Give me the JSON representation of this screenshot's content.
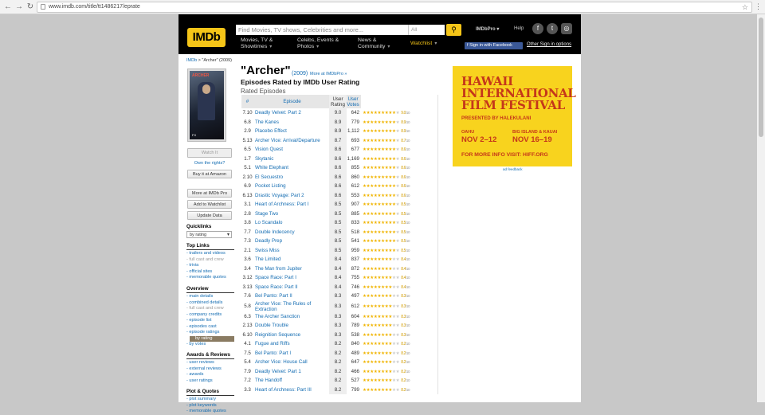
{
  "browser": {
    "url": "www.imdb.com/title/tt1486217/eprate"
  },
  "header": {
    "logo": "IMDb",
    "search_placeholder": "Find Movies, TV shows, Celebrities and more...",
    "search_category": "All",
    "imdbpro": "IMDbPro",
    "help": "Help",
    "menu": [
      "Movies, TV & Showtimes",
      "Celebs, Events & Photos",
      "News & Community",
      "Watchlist"
    ],
    "fb_signin": "Sign in with Facebook",
    "other_signin": "Other Sign in options"
  },
  "breadcrumb": {
    "home": "IMDb",
    "sep": " > ",
    "current": "\"Archer\" (2009)"
  },
  "poster": {
    "title": "ARCHER",
    "network": "FX"
  },
  "sidebar": {
    "watch": "Watch It",
    "own": "Own the rights?",
    "buy": "Buy it at Amazon",
    "more_pro": "More at IMDb Pro",
    "add_watchlist": "Add to Watchlist",
    "update": "Update Data",
    "quicklinks": "Quicklinks",
    "quick_select": "by rating",
    "top_links_h": "Top Links",
    "top_links": [
      "trailers and videos",
      "full cast and crew",
      "trivia",
      "official sites",
      "memorable quotes"
    ],
    "overview_h": "Overview",
    "overview": [
      "main details",
      "combined details",
      "full cast and crew",
      "company credits",
      "episode list",
      "episodes cast",
      "episode ratings",
      "by rating",
      "by votes"
    ],
    "awards_h": "Awards & Reviews",
    "awards": [
      "user reviews",
      "external reviews",
      "awards",
      "user ratings"
    ],
    "plot_h": "Plot & Quotes",
    "plot": [
      "plot summary",
      "plot keywords",
      "memorable quotes"
    ]
  },
  "main": {
    "title": "\"Archer\"",
    "year": "(2009)",
    "more_pro": "More at IMDbPro »",
    "subtitle": "Episodes Rated by IMDb User Rating",
    "rated_label": "Rated Episodes",
    "columns": [
      "#",
      "Episode",
      "User Rating",
      "User Votes"
    ],
    "episodes": [
      {
        "num": "7.10",
        "title": "Deadly Velvet: Part 2",
        "rating": "9.0",
        "votes": "642"
      },
      {
        "num": "6.8",
        "title": "The Kanes",
        "rating": "8.9",
        "votes": "779"
      },
      {
        "num": "2.9",
        "title": "Placebo Effect",
        "rating": "8.9",
        "votes": "1,112"
      },
      {
        "num": "5.13",
        "title": "Archer Vice: Arrival/Departure",
        "rating": "8.7",
        "votes": "693"
      },
      {
        "num": "6.5",
        "title": "Vision Quest",
        "rating": "8.6",
        "votes": "677"
      },
      {
        "num": "1.7",
        "title": "Skytanic",
        "rating": "8.6",
        "votes": "1,169"
      },
      {
        "num": "5.1",
        "title": "White Elephant",
        "rating": "8.6",
        "votes": "855"
      },
      {
        "num": "2.10",
        "title": "El Secuestro",
        "rating": "8.6",
        "votes": "860"
      },
      {
        "num": "6.9",
        "title": "Pocket Listing",
        "rating": "8.6",
        "votes": "612"
      },
      {
        "num": "6.13",
        "title": "Drastic Voyage: Part 2",
        "rating": "8.6",
        "votes": "553"
      },
      {
        "num": "3.1",
        "title": "Heart of Archness: Part I",
        "rating": "8.5",
        "votes": "907"
      },
      {
        "num": "2.8",
        "title": "Stage Two",
        "rating": "8.5",
        "votes": "885"
      },
      {
        "num": "3.8",
        "title": "Lo Scandalo",
        "rating": "8.5",
        "votes": "833"
      },
      {
        "num": "7.7",
        "title": "Double Indecency",
        "rating": "8.5",
        "votes": "518"
      },
      {
        "num": "7.3",
        "title": "Deadly Prep",
        "rating": "8.5",
        "votes": "541"
      },
      {
        "num": "2.1",
        "title": "Swiss Miss",
        "rating": "8.5",
        "votes": "959"
      },
      {
        "num": "3.6",
        "title": "The Limited",
        "rating": "8.4",
        "votes": "837"
      },
      {
        "num": "3.4",
        "title": "The Man from Jupiter",
        "rating": "8.4",
        "votes": "872"
      },
      {
        "num": "3.12",
        "title": "Space Race: Part I",
        "rating": "8.4",
        "votes": "755"
      },
      {
        "num": "3.13",
        "title": "Space Race: Part II",
        "rating": "8.4",
        "votes": "746"
      },
      {
        "num": "7.6",
        "title": "Bel Panto: Part II",
        "rating": "8.3",
        "votes": "497"
      },
      {
        "num": "5.8",
        "title": "Archer Vice: The Rules of Extraction",
        "rating": "8.3",
        "votes": "612"
      },
      {
        "num": "6.3",
        "title": "The Archer Sanction",
        "rating": "8.3",
        "votes": "604"
      },
      {
        "num": "2.13",
        "title": "Double Trouble",
        "rating": "8.3",
        "votes": "789"
      },
      {
        "num": "6.10",
        "title": "Reignition Sequence",
        "rating": "8.3",
        "votes": "538"
      },
      {
        "num": "4.1",
        "title": "Fugue and Riffs",
        "rating": "8.2",
        "votes": "840"
      },
      {
        "num": "7.5",
        "title": "Bel Panto: Part I",
        "rating": "8.2",
        "votes": "489"
      },
      {
        "num": "5.4",
        "title": "Archer Vice: House Call",
        "rating": "8.2",
        "votes": "647"
      },
      {
        "num": "7.9",
        "title": "Deadly Velvet: Part 1",
        "rating": "8.2",
        "votes": "466"
      },
      {
        "num": "7.2",
        "title": "The Handoff",
        "rating": "8.2",
        "votes": "527"
      },
      {
        "num": "3.3",
        "title": "Heart of Archness: Part III",
        "rating": "8.2",
        "votes": "799"
      }
    ]
  },
  "ad": {
    "line1": "HAWAII",
    "line2": "INTERNATIONAL",
    "line3": "FILM FESTIVAL",
    "presented": "PRESENTED BY HALEKULANI",
    "loc1": "OAHU",
    "dates1": "NOV 2–12",
    "loc2": "BIG ISLAND & KAUAI",
    "dates2": "NOV 16–19",
    "info": "FOR MORE INFO VISIT: HIFF.ORG",
    "feedback": "ad feedback"
  }
}
